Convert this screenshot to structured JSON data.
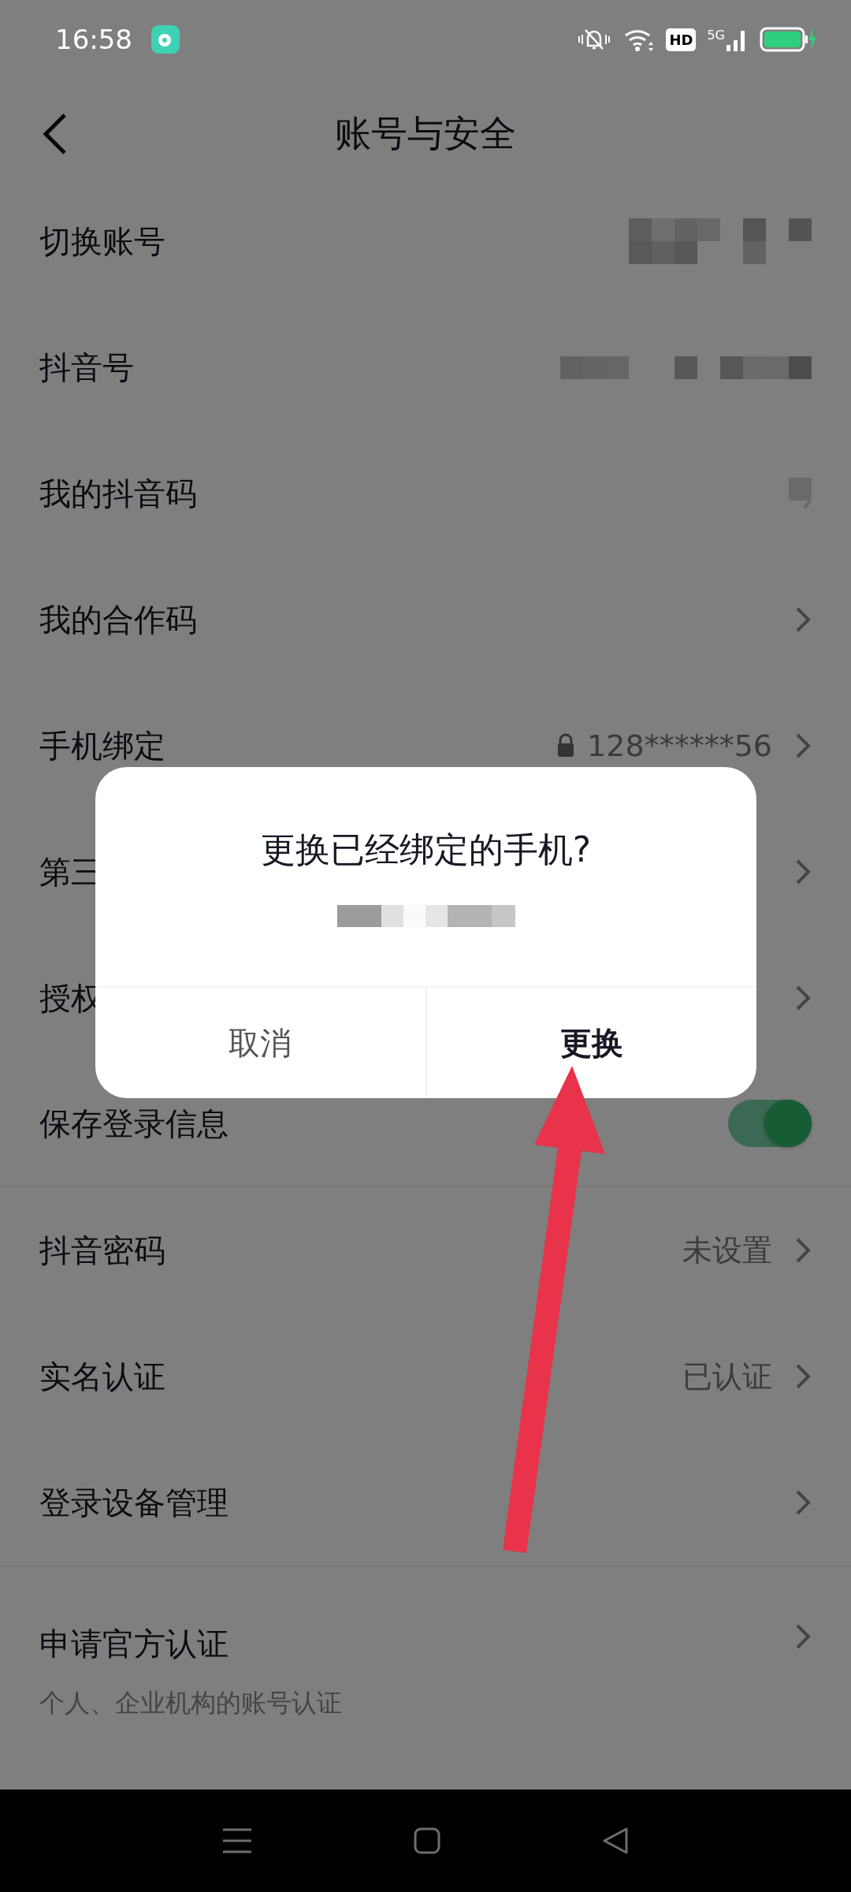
{
  "status_bar": {
    "time": "16:58",
    "hd": "HD",
    "network": "5G"
  },
  "header": {
    "title": "账号与安全"
  },
  "rows": [
    {
      "label": "切换账号",
      "kind": "mosaic"
    },
    {
      "label": "抖音号",
      "kind": "mosaic-wide"
    },
    {
      "label": "我的抖音码",
      "kind": "faint"
    },
    {
      "label": "我的合作码",
      "kind": "chevron"
    },
    {
      "label": "手机绑定",
      "value": "128******56",
      "kind": "chevron",
      "lock": true
    },
    {
      "label": "第三",
      "kind": "chevron"
    },
    {
      "label": "授权",
      "kind": "chevron"
    },
    {
      "label": "保存登录信息",
      "kind": "toggle",
      "on": true
    },
    {
      "label": "抖音密码",
      "value": "未设置",
      "kind": "chevron"
    },
    {
      "label": "实名认证",
      "value": "已认证",
      "kind": "chevron"
    },
    {
      "label": "登录设备管理",
      "kind": "chevron"
    },
    {
      "label": "申请官方认证",
      "sub": "个人、企业机构的账号认证",
      "kind": "chevron"
    }
  ],
  "dialog": {
    "title": "更换已经绑定的手机?",
    "buttons": [
      {
        "label": "取消",
        "primary": false
      },
      {
        "label": "更换",
        "primary": true
      }
    ]
  }
}
